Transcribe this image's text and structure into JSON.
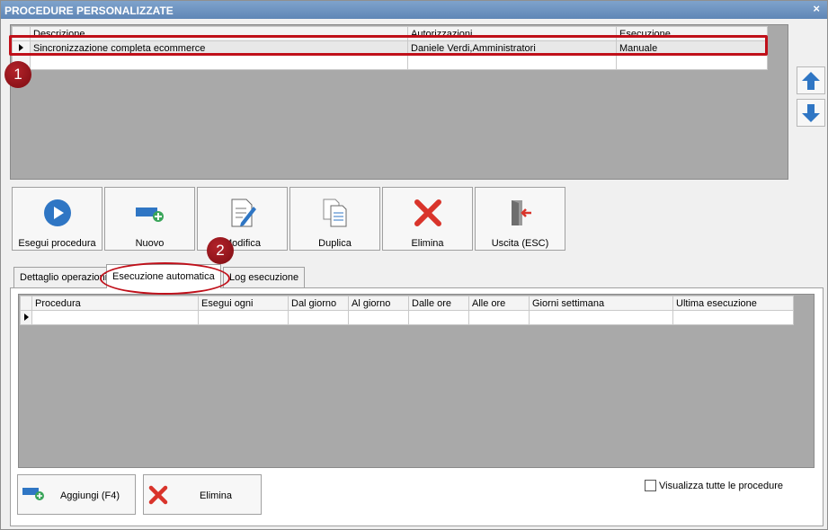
{
  "window": {
    "title": "PROCEDURE PERSONALIZZATE",
    "close": "×"
  },
  "top_grid": {
    "columns": [
      "Descrizione",
      "Autorizzazioni",
      "Esecuzione"
    ],
    "rows": [
      [
        "Sincronizzazione completa ecommerce",
        "Daniele Verdi,Amministratori",
        "Manuale"
      ]
    ]
  },
  "badges": {
    "one": "1",
    "two": "2"
  },
  "toolbar": {
    "run": "Esegui procedura",
    "new": "Nuovo",
    "edit": "Modifica",
    "duplicate": "Duplica",
    "delete": "Elimina",
    "exit": "Uscita (ESC)"
  },
  "tabs": [
    "Dettaglio operazioni",
    "Esecuzione automatica",
    "Log esecuzione"
  ],
  "bottom_grid": {
    "columns": [
      "Procedura",
      "Esegui ogni",
      "Dal giorno",
      "Al giorno",
      "Dalle ore",
      "Alle ore",
      "Giorni settimana",
      "Ultima esecuzione"
    ]
  },
  "actions": {
    "add": "Aggiungi (F4)",
    "delete": "Elimina"
  },
  "checkbox": {
    "label": "Visualizza tutte le procedure",
    "checked": false
  },
  "colors": {
    "accent_red": "#c0101a",
    "title_blue": "#6a8fbe",
    "icon_blue": "#2f76c4"
  }
}
